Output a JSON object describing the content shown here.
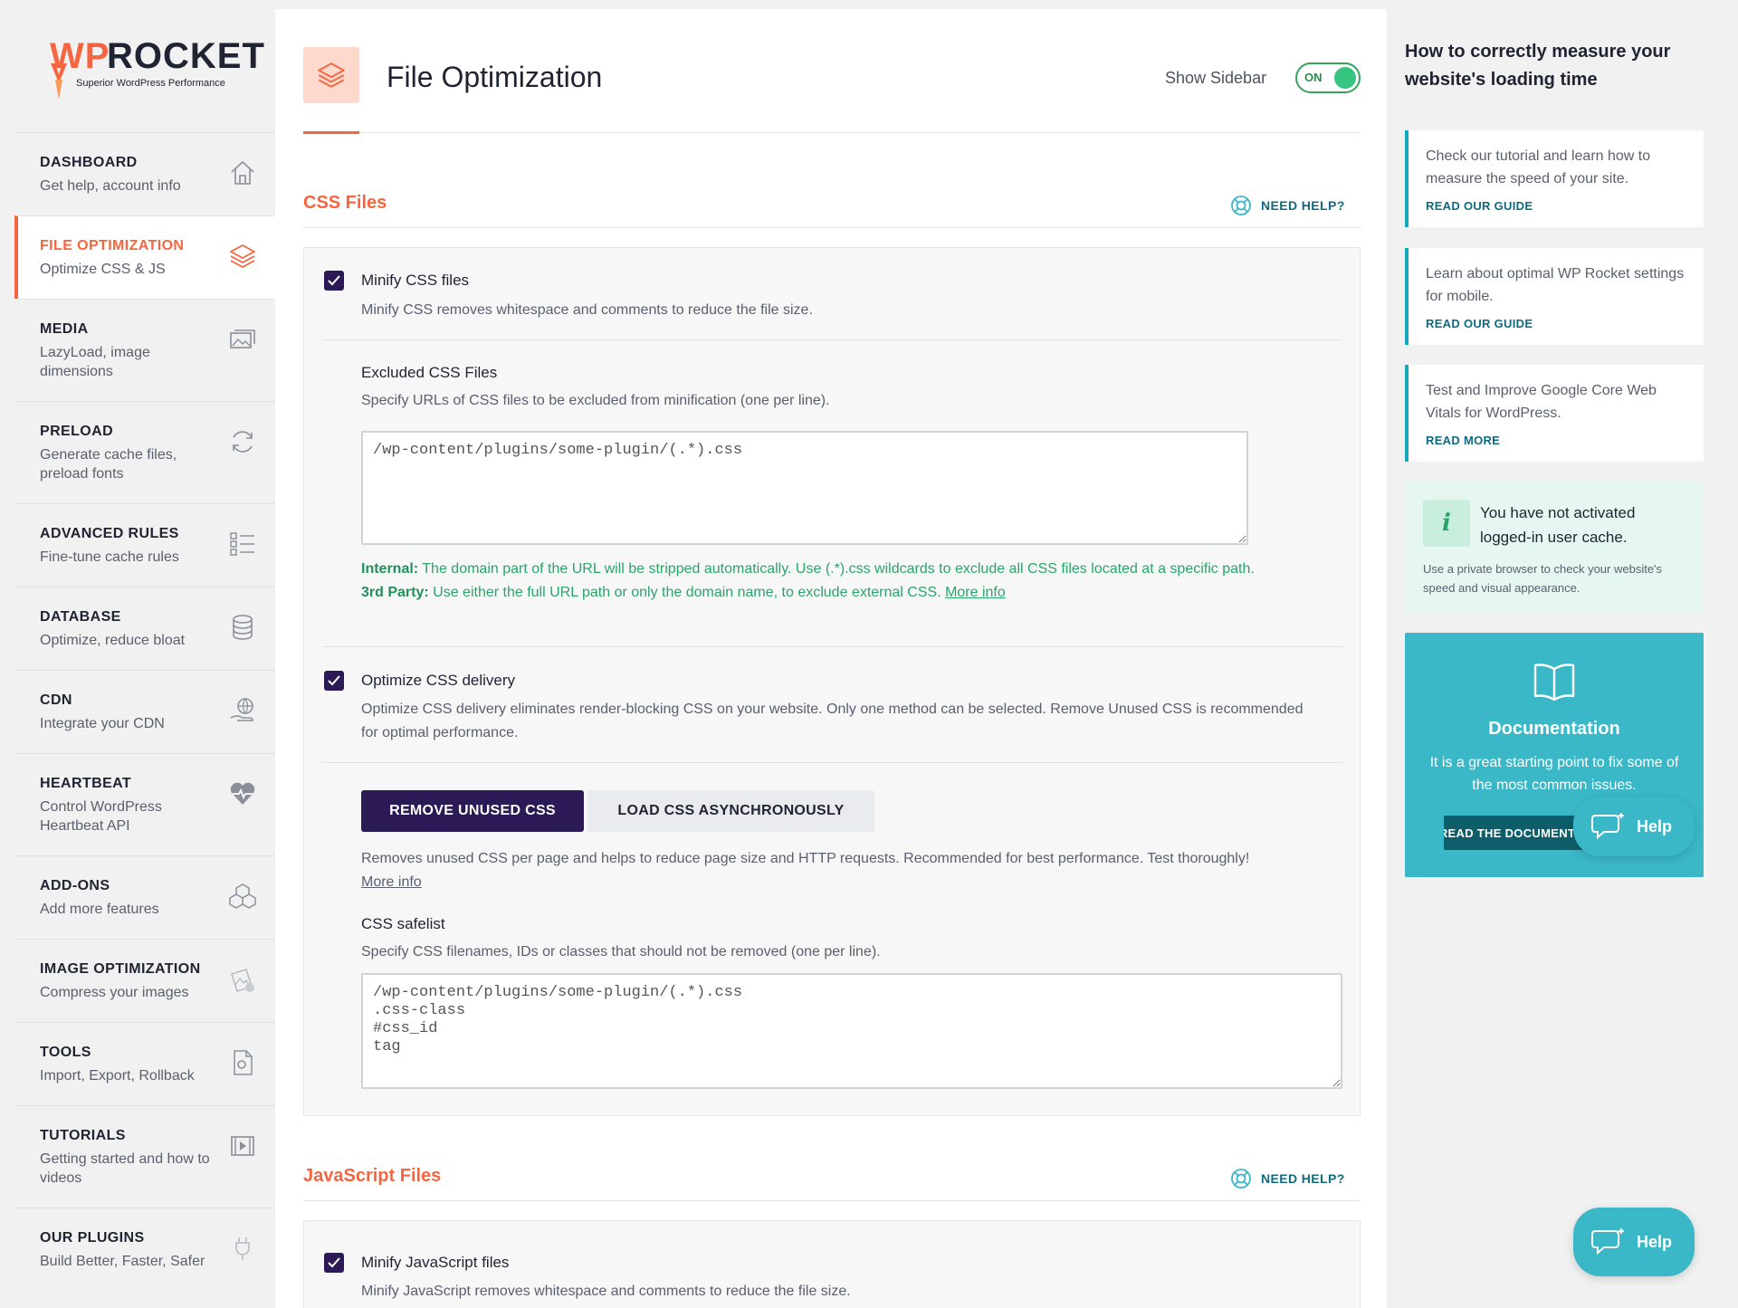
{
  "brand": {
    "name_wp": "WP",
    "name_rocket": "ROCKET",
    "tagline": "Superior WordPress Performance",
    "accent": "#f56640",
    "primary": "#2b1a55",
    "teal": "#3bb8c8"
  },
  "sidebar": {
    "items": [
      {
        "title": "DASHBOARD",
        "subtitle": "Get help, account info",
        "icon": "home-icon"
      },
      {
        "title": "FILE OPTIMIZATION",
        "subtitle": "Optimize CSS & JS",
        "icon": "layers-icon",
        "active": true
      },
      {
        "title": "MEDIA",
        "subtitle": "LazyLoad, image dimensions",
        "icon": "images-icon"
      },
      {
        "title": "PRELOAD",
        "subtitle": "Generate cache files, preload fonts",
        "icon": "refresh-icon"
      },
      {
        "title": "ADVANCED RULES",
        "subtitle": "Fine-tune cache rules",
        "icon": "list-icon"
      },
      {
        "title": "DATABASE",
        "subtitle": "Optimize, reduce bloat",
        "icon": "database-icon"
      },
      {
        "title": "CDN",
        "subtitle": "Integrate your CDN",
        "icon": "globe-hand-icon"
      },
      {
        "title": "HEARTBEAT",
        "subtitle": "Control WordPress Heartbeat API",
        "icon": "heartbeat-icon"
      },
      {
        "title": "ADD-ONS",
        "subtitle": "Add more features",
        "icon": "cubes-icon"
      },
      {
        "title": "IMAGE OPTIMIZATION",
        "subtitle": "Compress your images",
        "icon": "image-compress-icon"
      },
      {
        "title": "TOOLS",
        "subtitle": "Import, Export, Rollback",
        "icon": "tools-file-icon"
      },
      {
        "title": "TUTORIALS",
        "subtitle": "Getting started and how to videos",
        "icon": "video-icon"
      },
      {
        "title": "OUR PLUGINS",
        "subtitle": "Build Better, Faster, Safer",
        "icon": "plug-icon"
      }
    ]
  },
  "header": {
    "title": "File Optimization",
    "show_sidebar_label": "Show Sidebar",
    "toggle_state": "ON"
  },
  "css_section": {
    "title": "CSS Files",
    "need_help": "NEED HELP?",
    "minify": {
      "label": "Minify CSS files",
      "desc": "Minify CSS removes whitespace and comments to reduce the file size.",
      "checked": true
    },
    "excluded": {
      "label": "Excluded CSS Files",
      "desc": "Specify URLs of CSS files to be excluded from minification (one per line).",
      "value": "/wp-content/plugins/some-plugin/(.*).css",
      "internal_label": "Internal:",
      "internal_text": " The domain part of the URL will be stripped automatically. Use (.*).css wildcards to exclude all CSS files located at a specific path.",
      "third_label": "3rd Party:",
      "third_text": " Use either the full URL path or only the domain name, to exclude external CSS. ",
      "more_info": "More info"
    },
    "optimize_delivery": {
      "label": "Optimize CSS delivery",
      "desc": "Optimize CSS delivery eliminates render-blocking CSS on your website. Only one method can be selected. Remove Unused CSS is recommended for optimal performance.",
      "checked": true
    },
    "method_buttons": {
      "remove_unused": "REMOVE UNUSED CSS",
      "load_async": "LOAD CSS ASYNCHRONOUSLY"
    },
    "rucss_desc": "Removes unused CSS per page and helps to reduce page size and HTTP requests. Recommended for best performance. Test thoroughly!",
    "rucss_more": "More info",
    "safelist": {
      "label": "CSS safelist",
      "desc": "Specify CSS filenames, IDs or classes that should not be removed (one per line).",
      "value": "/wp-content/plugins/some-plugin/(.*).css\n.css-class\n#css_id\ntag"
    }
  },
  "js_section": {
    "title": "JavaScript Files",
    "need_help": "NEED HELP?",
    "minify": {
      "label": "Minify JavaScript files",
      "desc": "Minify JavaScript removes whitespace and comments to reduce the file size.",
      "checked": true
    }
  },
  "right_sidebar": {
    "title": "How to correctly measure your website's loading time",
    "cards": [
      {
        "text": "Check our tutorial and learn how to measure the speed of your site.",
        "cta": "READ OUR GUIDE"
      },
      {
        "text": "Learn about optimal WP Rocket settings for mobile.",
        "cta": "READ OUR GUIDE"
      },
      {
        "text": "Test and Improve Google Core Web Vitals for WordPress.",
        "cta": "READ MORE"
      }
    ],
    "notice": {
      "icon": "i",
      "heading": "You have not activated logged-in user cache.",
      "text": "Use a private browser to check your website's speed and visual appearance."
    },
    "documentation": {
      "title": "Documentation",
      "text": "It is a great starting point to fix some of the most common issues.",
      "button": "READ THE DOCUMENTATION"
    }
  },
  "help_widget": {
    "label": "Help"
  }
}
